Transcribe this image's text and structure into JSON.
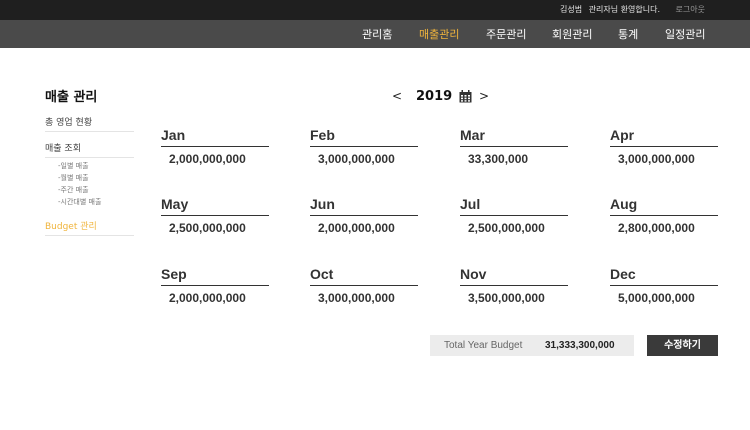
{
  "header": {
    "user_name": "김성범",
    "welcome_text": "관리자님 환영합니다.",
    "logout_label": "로그아웃"
  },
  "nav": {
    "items": [
      {
        "label": "관리홈"
      },
      {
        "label": "매출관리",
        "active": true
      },
      {
        "label": "주문관리"
      },
      {
        "label": "회원관리"
      },
      {
        "label": "통계"
      },
      {
        "label": "일정관리"
      }
    ]
  },
  "sidebar": {
    "title": "매출 관리",
    "items": [
      {
        "label": "총 영업 현황"
      },
      {
        "label": "매출 조회"
      },
      {
        "label": "-일별 매출"
      },
      {
        "label": "-월별 매출"
      },
      {
        "label": "-주간 매출"
      },
      {
        "label": "-시간대별 매출"
      },
      {
        "label": "Budget 관리",
        "active": true
      }
    ]
  },
  "year_nav": {
    "prev": "<",
    "year": "2019",
    "next": ">",
    "calendar_icon": "calendar-icon"
  },
  "months": [
    {
      "name": "Jan",
      "value": "2,000,000,000"
    },
    {
      "name": "Feb",
      "value": "3,000,000,000"
    },
    {
      "name": "Mar",
      "value": "33,300,000"
    },
    {
      "name": "Apr",
      "value": "3,000,000,000"
    },
    {
      "name": "May",
      "value": "2,500,000,000"
    },
    {
      "name": "Jun",
      "value": "2,000,000,000"
    },
    {
      "name": "Jul",
      "value": "2,500,000,000"
    },
    {
      "name": "Aug",
      "value": "2,800,000,000"
    },
    {
      "name": "Sep",
      "value": "2,000,000,000"
    },
    {
      "name": "Oct",
      "value": "3,000,000,000"
    },
    {
      "name": "Nov",
      "value": "3,500,000,000"
    },
    {
      "name": "Dec",
      "value": "5,000,000,000"
    }
  ],
  "summary": {
    "total_label": "Total Year Budget",
    "total_value": "31,333,300,000",
    "edit_label": "수정하기"
  },
  "colors": {
    "accent": "#f0b43c",
    "topbar": "#1f1f1f",
    "navbar": "#4a4a4a"
  }
}
